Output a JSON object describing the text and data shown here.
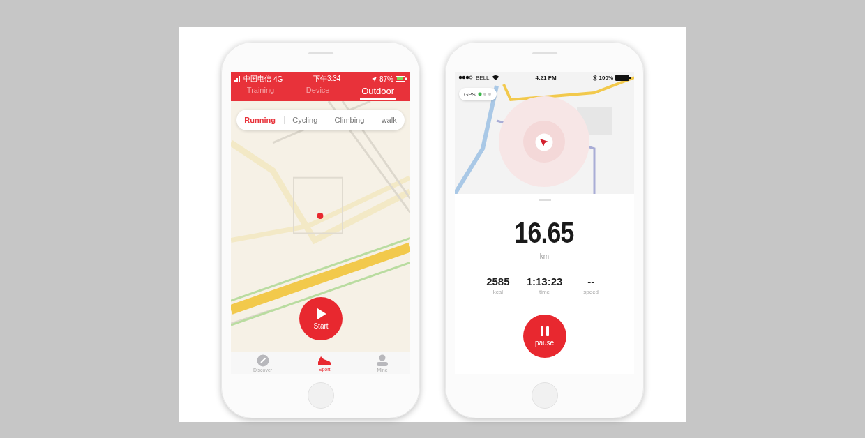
{
  "left_screen": {
    "status_bar": {
      "carrier": "中国电信",
      "network": "4G",
      "time": "下午3:34",
      "battery": "87%"
    },
    "tabs": [
      {
        "label": "Training",
        "selected": false
      },
      {
        "label": "Device",
        "selected": false
      },
      {
        "label": "Outdoor",
        "selected": true
      }
    ],
    "sport_types": [
      {
        "label": "Running",
        "selected": true
      },
      {
        "label": "Cycling",
        "selected": false
      },
      {
        "label": "Climbing",
        "selected": false
      },
      {
        "label": "walk",
        "selected": false
      }
    ],
    "start_button": {
      "label": "Start"
    },
    "bottom_nav": [
      {
        "label": "Discover",
        "kind": "compass",
        "selected": false
      },
      {
        "label": "Sport",
        "kind": "shoe",
        "selected": true
      },
      {
        "label": "Mine",
        "kind": "person",
        "selected": false
      }
    ]
  },
  "right_screen": {
    "status_bar": {
      "carrier": "BELL",
      "time": "4:21 PM",
      "battery": "100%"
    },
    "gps": {
      "label": "GPS"
    },
    "distance": {
      "value": "16.65",
      "unit": "km"
    },
    "stats": [
      {
        "value": "2585",
        "label": "kcal"
      },
      {
        "value": "1:13:23",
        "label": "time"
      },
      {
        "value": "--",
        "label": "speed"
      }
    ],
    "pause_button": {
      "label": "pause"
    }
  }
}
